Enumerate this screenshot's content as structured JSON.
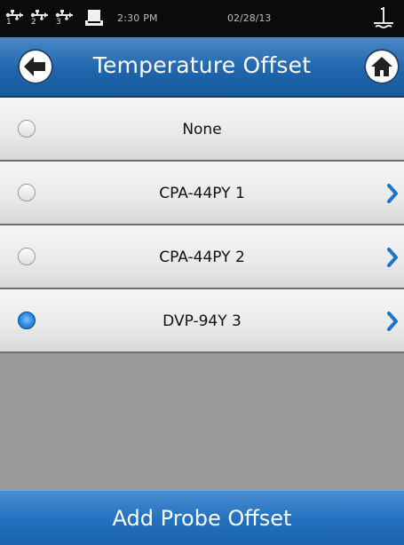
{
  "status_bar": {
    "usb_ports": [
      "1",
      "2",
      "3"
    ],
    "time": "2:30 PM",
    "date": "02/28/13",
    "icons": [
      "usb-icon",
      "printer-icon",
      "probe-icon"
    ]
  },
  "header": {
    "title": "Temperature Offset",
    "back_icon": "arrow-left-icon",
    "home_icon": "home-icon",
    "colors": {
      "header": "#1f66ad",
      "accent": "#2a86dd"
    }
  },
  "options": [
    {
      "label": "None",
      "selected": false,
      "has_detail": false
    },
    {
      "label": "CPA-44PY 1",
      "selected": false,
      "has_detail": true
    },
    {
      "label": "CPA-44PY 2",
      "selected": false,
      "has_detail": true
    },
    {
      "label": "DVP-94Y 3",
      "selected": true,
      "has_detail": true
    }
  ],
  "footer": {
    "button_label": "Add Probe Offset"
  }
}
